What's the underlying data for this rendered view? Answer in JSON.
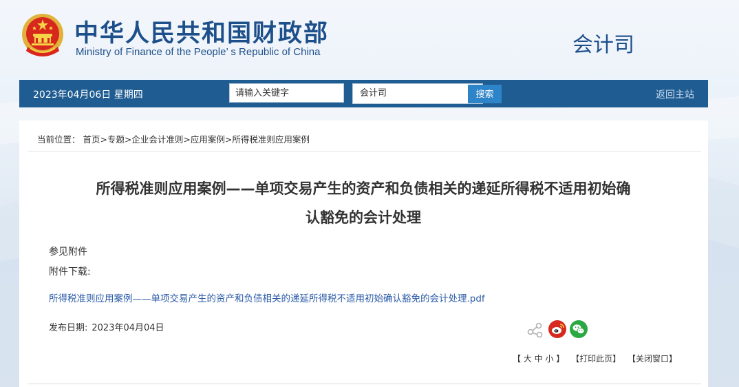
{
  "header": {
    "site_name_cn": "中华人民共和国财政部",
    "site_name_en": "Ministry of Finance of the People’ s Republic of China",
    "department": "会计司",
    "emblem_icon": "national-emblem-icon"
  },
  "nav": {
    "date": "2023年04月06日  星期四",
    "search_placeholder": "请输入关键字",
    "scope_selected": "会计司",
    "search_button": "搜索",
    "home_link": "返回主站"
  },
  "article": {
    "breadcrumb": "当前位置：  首页>专题>企业会计准则>应用案例>所得税准则应用案例",
    "title_line1": "所得税准则应用案例——单项交易产生的资产和负债相关的递延所得税不适用初始确",
    "title_line2": "认豁免的会计处理",
    "see_attachment": "参见附件",
    "download_label": "附件下载:",
    "attachment_link": "所得税准则应用案例——单项交易产生的资产和负债相关的递延所得税不适用初始确认豁免的会计处理.pdf",
    "publish_label": "发布日期:",
    "publish_date": "2023年04月04日"
  },
  "share": {
    "share_icon": "share-icon",
    "weibo_icon": "weibo-icon",
    "wechat_icon": "wechat-icon"
  },
  "tools": {
    "font_size": "【 大 中 小 】",
    "print": "【打印此页】",
    "close": "【关闭窗口】"
  },
  "colors": {
    "brand_blue": "#1d4f8a",
    "nav_bg": "#1f5c92",
    "search_btn": "#2e84c8",
    "link_blue": "#2a5aa7",
    "weibo_red": "#d62a1e",
    "wechat_green": "#2aa843"
  }
}
